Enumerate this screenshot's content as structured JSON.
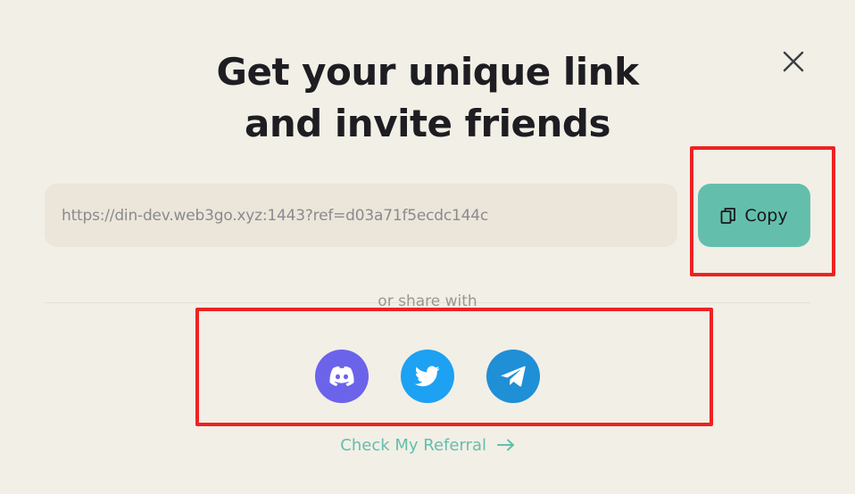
{
  "modal": {
    "title_line1": "Get your unique link",
    "title_line2": "and invite friends",
    "close_icon": "close-icon"
  },
  "referral": {
    "link": "https://din-dev.web3go.xyz:1443?ref=d03a71f5ecdc144c",
    "copy_label": "Copy",
    "copy_icon": "copy-icon"
  },
  "share": {
    "label": "or share with",
    "options": [
      {
        "name": "Discord",
        "icon": "discord-icon",
        "color": "#6b63ea"
      },
      {
        "name": "Twitter",
        "icon": "twitter-icon",
        "color": "#1da1f2"
      },
      {
        "name": "Telegram",
        "icon": "telegram-icon",
        "color": "#1f8fd6"
      }
    ]
  },
  "footer": {
    "check_referral_label": "Check My Referral",
    "arrow_icon": "arrow-right-icon"
  },
  "colors": {
    "background": "#f2efe6",
    "accent": "#63bfac",
    "highlight": "#ee2222"
  }
}
